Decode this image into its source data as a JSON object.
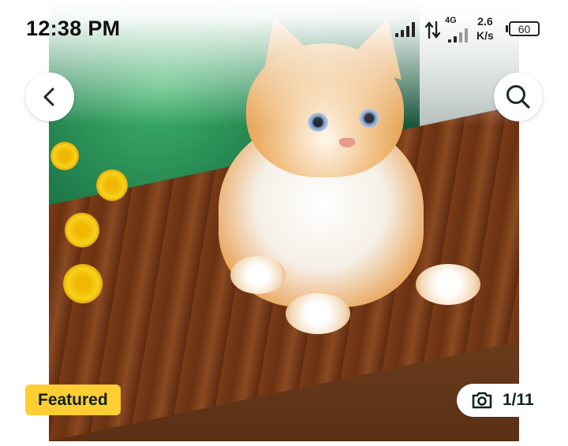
{
  "status_bar": {
    "time": "12:38 PM",
    "network_type": "4G",
    "speed_value": "2.6",
    "speed_unit": "K/s",
    "battery": "60"
  },
  "header": {
    "back_icon": "chevron-left-icon",
    "search_icon": "search-icon"
  },
  "gallery": {
    "badge": "Featured",
    "counter": "1/11",
    "camera_icon": "camera-icon"
  },
  "colors": {
    "badge": "#ffce32",
    "text_dark": "#0f2424"
  }
}
